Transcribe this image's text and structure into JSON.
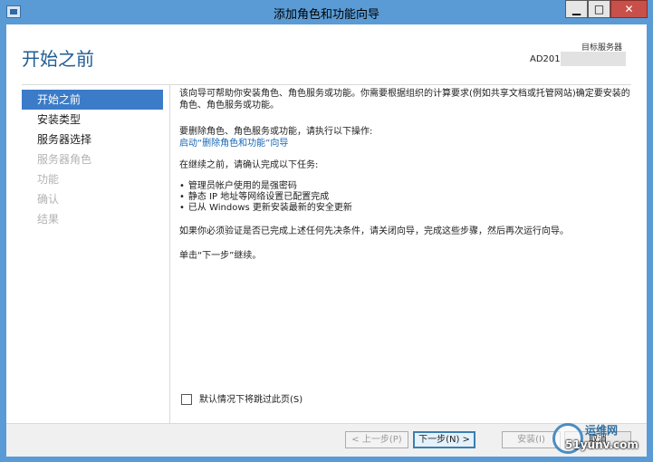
{
  "window": {
    "title": "添加角色和功能向导",
    "controls": {
      "minimize": "▁",
      "maximize": "□",
      "close": "✕"
    }
  },
  "header": {
    "heading": "开始之前",
    "destination_label": "目标服务器",
    "destination_server": "AD2012"
  },
  "nav": {
    "items": [
      {
        "label": "开始之前",
        "state": "active"
      },
      {
        "label": "安装类型",
        "state": "enabled"
      },
      {
        "label": "服务器选择",
        "state": "enabled"
      },
      {
        "label": "服务器角色",
        "state": "disabled"
      },
      {
        "label": "功能",
        "state": "disabled"
      },
      {
        "label": "确认",
        "state": "disabled"
      },
      {
        "label": "结果",
        "state": "disabled"
      }
    ]
  },
  "content": {
    "intro": "该向导可帮助你安装角色、角色服务或功能。你需要根据组织的计算要求(例如共享文档或托管网站)确定要安装的角色、角色服务或功能。",
    "remove_heading": "要删除角色、角色服务或功能，请执行以下操作:",
    "remove_link": "启动“删除角色和功能”向导",
    "before_heading": "在继续之前，请确认完成以下任务:",
    "bullets": [
      "管理员帐户使用的是强密码",
      "静态 IP 地址等网络设置已配置完成",
      "已从 Windows 更新安装最新的安全更新"
    ],
    "verify": "如果你必须验证是否已完成上述任何先决条件，请关闭向导，完成这些步骤，然后再次运行向导。",
    "next_note": "单击“下一步”继续。"
  },
  "skip": {
    "label": "默认情况下将跳过此页(S)",
    "checked": false
  },
  "footer": {
    "prev": "< 上一步(P)",
    "next": "下一步(N) >",
    "install": "安装(I)",
    "cancel": "取消"
  },
  "watermark": {
    "line1": "运维网",
    "line2": "51yunv.com"
  },
  "colors": {
    "titlebar": "#5a9bd5",
    "accent": "#3b7bc8",
    "heading": "#1f5e94",
    "link": "#1667b5",
    "close": "#c7504a"
  }
}
